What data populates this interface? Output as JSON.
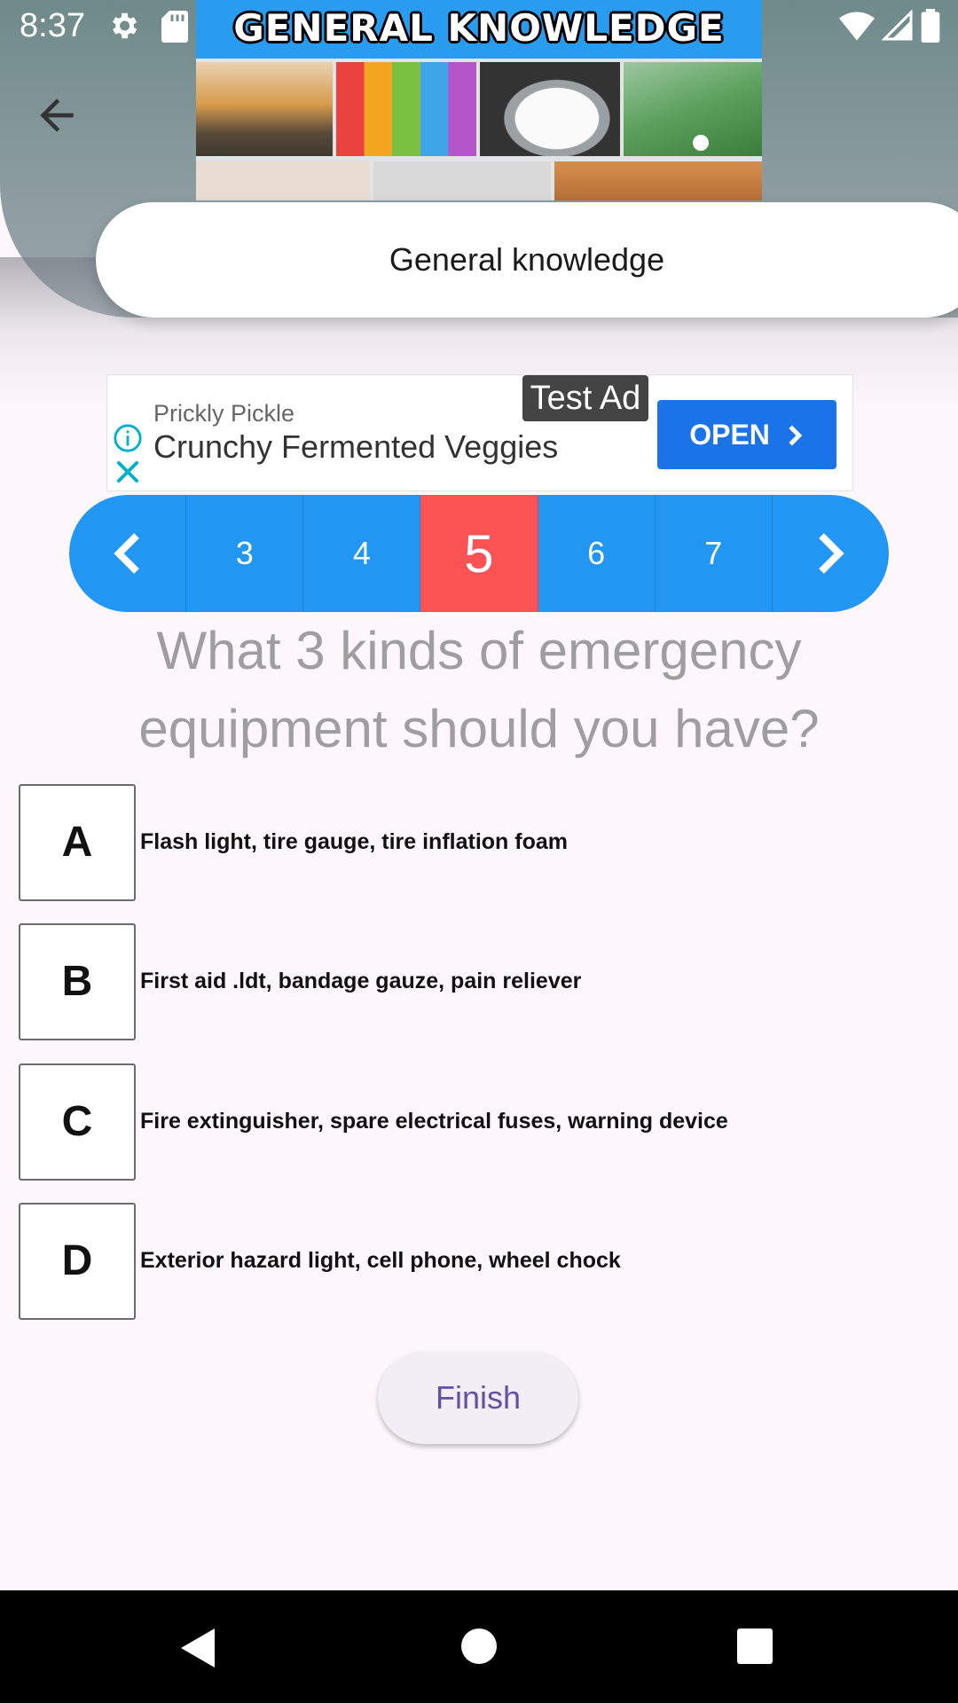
{
  "status_bar": {
    "time": "8:37",
    "icons": [
      "settings-icon",
      "sd-card-icon",
      "wifi-icon",
      "signal-icon",
      "battery-icon"
    ]
  },
  "header": {
    "banner_title": "GENERAL KNOWLEDGE",
    "back_icon": "arrow-left-icon",
    "quiz_title": "General knowledge",
    "colors": {
      "header_bg": "#6f8a8a",
      "banner_bg": "#2a9cf0"
    }
  },
  "ad": {
    "badge": "Test Ad",
    "advertiser": "Prickly Pickle",
    "headline": "Crunchy Fermented Veggies",
    "cta": "OPEN",
    "icons": [
      "info-icon",
      "close-icon",
      "chevron-right-icon"
    ],
    "colors": {
      "cta_bg": "#1a73e8"
    }
  },
  "pager": {
    "prev_icon": "chevron-left-icon",
    "next_icon": "chevron-right-icon",
    "pages": [
      "3",
      "4",
      "5",
      "6",
      "7"
    ],
    "active": "5",
    "colors": {
      "bg": "#2196f3",
      "active_bg": "#fb5353"
    }
  },
  "question": {
    "text": "What 3 kinds of emergency equipment should you have?"
  },
  "options": [
    {
      "letter": "A",
      "text": "Flash light, tire gauge, tire inflation foam"
    },
    {
      "letter": "B",
      "text": "First aid .ldt, bandage gauze, pain reliever"
    },
    {
      "letter": "C",
      "text": "Fire extinguisher, spare electrical fuses, warning device"
    },
    {
      "letter": "D",
      "text": "Exterior hazard light, cell phone, wheel chock"
    }
  ],
  "finish_label": "Finish",
  "nav_bar": {
    "icons": [
      "back-triangle-icon",
      "home-circle-icon",
      "recents-square-icon"
    ]
  }
}
